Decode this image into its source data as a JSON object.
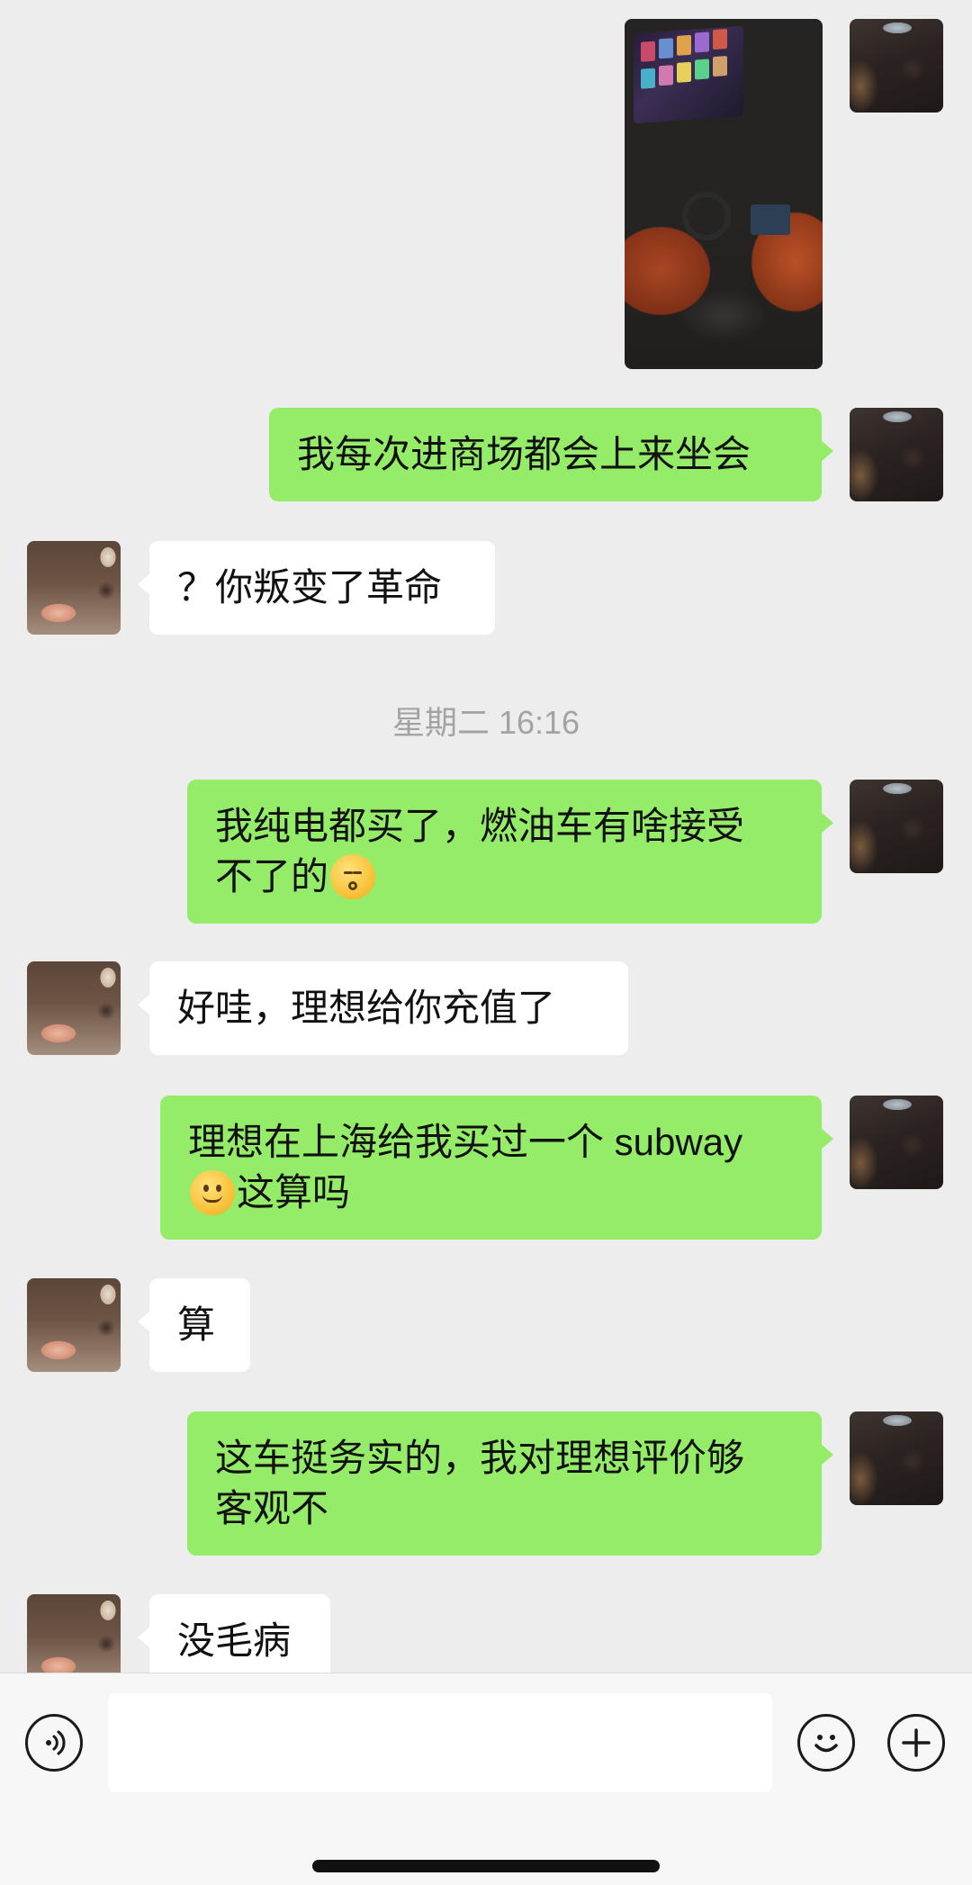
{
  "messages": {
    "m1": "我每次进商场都会上来坐会",
    "m2": "？你叛变了革命",
    "m3_line1": "我纯电都买了，燃油车有啥接受",
    "m3_line2": "不了的",
    "m4": "好哇，理想给你充值了",
    "m5_line1": "理想在上海给我买过一个 subway",
    "m5_line2": "这算吗",
    "m6": "算",
    "m7_line1": "这车挺务实的，我对理想评价够",
    "m7_line2": "客观不",
    "m8": "没毛病"
  },
  "timestamp": "星期二 16:16",
  "emojis": {
    "m3": "kiss-face-emoji",
    "m5": "smile-emoji"
  },
  "input": {
    "placeholder": ""
  },
  "colors": {
    "background": "#ededed",
    "my_bubble": "#95ec69",
    "their_bubble": "#ffffff",
    "timestamp": "#a3a3a3"
  }
}
